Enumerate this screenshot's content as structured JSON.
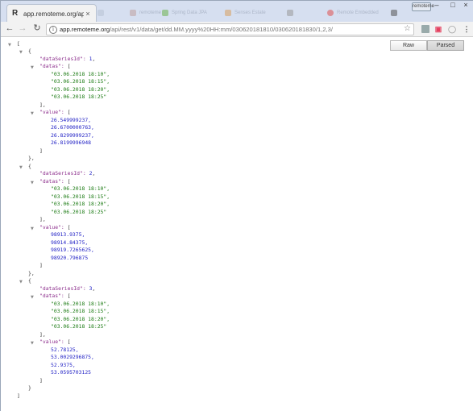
{
  "browser": {
    "active_tab": {
      "favicon": "R",
      "title": "app.remoteme.org/api/re",
      "close": "×"
    },
    "background_tabs": [
      "",
      "remoteme",
      "Spring Data JPA",
      "Senses Estate",
      "",
      "Remote Embedded",
      ""
    ],
    "window_label": "remoteme",
    "window_controls": {
      "minimize": "–",
      "maximize": "□",
      "close": "×"
    },
    "url": {
      "host": "app.remoteme.org",
      "path": "/api/rest/v1/data/get/dd.MM.yyyy%20HH:mm/030620181810/030620181830/1,2,3/"
    }
  },
  "viewer": {
    "raw_label": "Raw",
    "parsed_label": "Parsed",
    "active": "Parsed"
  },
  "json": [
    {
      "dataSeriesId": "1",
      "datas": [
        "\"03.06.2018 18:10\",",
        "\"03.06.2018 18:15\",",
        "\"03.06.2018 18:20\",",
        "\"03.06.2018 18:25\""
      ],
      "value": [
        "26.549999237,",
        "26.6700000763,",
        "26.8299999237,",
        "26.8199996948"
      ]
    },
    {
      "dataSeriesId": "2",
      "datas": [
        "\"03.06.2018 18:10\",",
        "\"03.06.2018 18:15\",",
        "\"03.06.2018 18:20\",",
        "\"03.06.2018 18:25\""
      ],
      "value": [
        "98913.9375,",
        "98914.84375,",
        "98919.7265625,",
        "98920.796875"
      ]
    },
    {
      "dataSeriesId": "3",
      "datas": [
        "\"03.06.2018 18:10\",",
        "\"03.06.2018 18:15\",",
        "\"03.06.2018 18:20\",",
        "\"03.06.2018 18:25\""
      ],
      "value": [
        "52.78125,",
        "53.0029296875,",
        "52.9375,",
        "53.0595703125"
      ]
    }
  ],
  "syntax": {
    "key_dataSeriesId": "\"dataSeriesId\": ",
    "key_datas": "\"datas\": ",
    "key_value": "\"value\": "
  },
  "colors": {
    "key": "#8b2c8b",
    "string": "#1a7a12",
    "number": "#1d1dc4"
  },
  "icons": {
    "back": "back-arrow-icon",
    "forward": "forward-arrow-icon",
    "reload": "reload-icon",
    "star": "star-icon",
    "menu": "kebab-menu-icon"
  }
}
